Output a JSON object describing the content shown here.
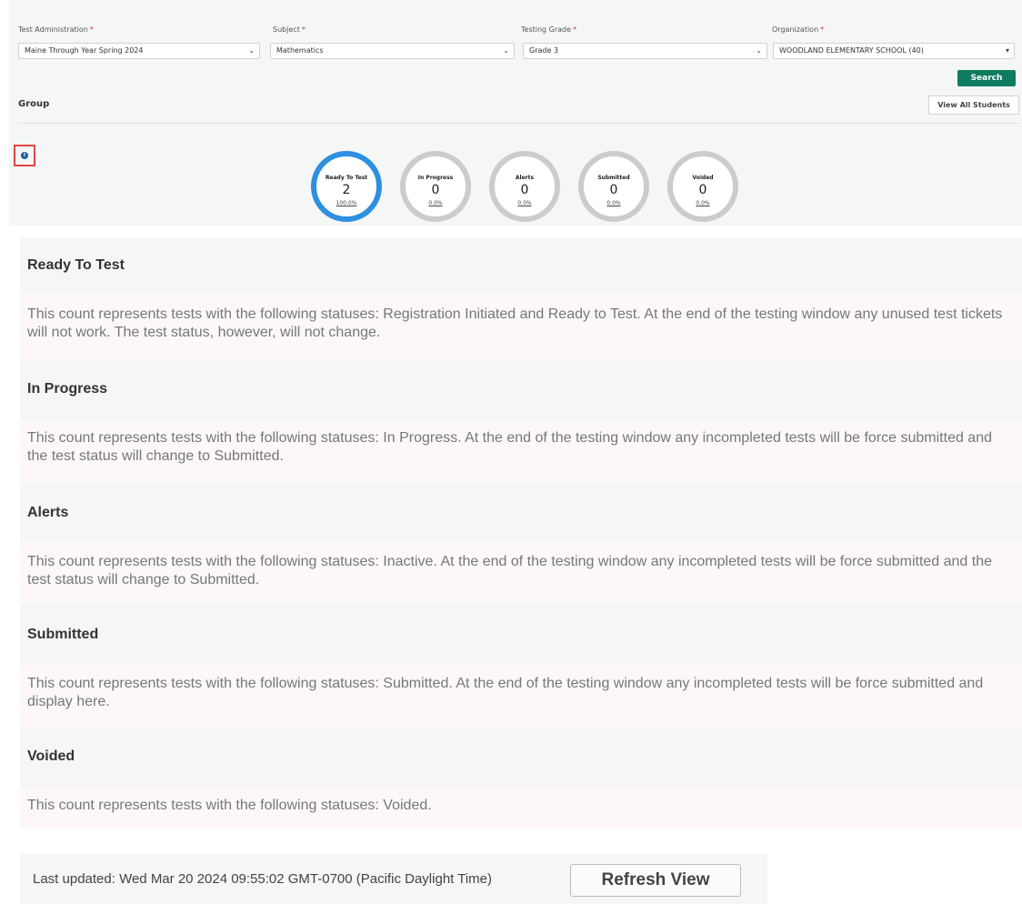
{
  "filters": {
    "test_administration": {
      "label": "Test Administration",
      "required_mark": "*",
      "value": "Maine Through Year Spring 2024"
    },
    "subject": {
      "label": "Subject",
      "required_mark": "*",
      "value": "Mathematics"
    },
    "testing_grade": {
      "label": "Testing Grade",
      "required_mark": "*",
      "value": "Grade 3"
    },
    "organization": {
      "label": "Organization",
      "required_mark": "*",
      "value": "WOODLAND ELEMENTARY SCHOOL (40)"
    },
    "caret_glyph": "⌄",
    "org_caret_glyph": "▾"
  },
  "buttons": {
    "search": "Search",
    "view_all_students": "View All Students",
    "refresh_view": "Refresh View"
  },
  "group": {
    "title": "Group"
  },
  "info_icon": {
    "glyph": "i",
    "icon": "info-icon"
  },
  "statuses": [
    {
      "label": "Ready To Test",
      "count": "2",
      "percent": "100.0%",
      "active": true
    },
    {
      "label": "In Progress",
      "count": "0",
      "percent": "0.0%",
      "active": false
    },
    {
      "label": "Alerts",
      "count": "0",
      "percent": "0.0%",
      "active": false
    },
    {
      "label": "Submitted",
      "count": "0",
      "percent": "0.0%",
      "active": false
    },
    {
      "label": "Voided",
      "count": "0",
      "percent": "0.0%",
      "active": false
    }
  ],
  "legend": [
    {
      "title": "Ready To Test",
      "description": "This count represents tests with the following statuses: Registration Initiated and Ready to Test. At the end of the testing window any unused test tickets will not work. The test status, however, will not change."
    },
    {
      "title": "In Progress",
      "description": "This count represents tests with the following statuses: In Progress. At the end of the testing window any incompleted tests will be force submitted and the test status will change to Submitted."
    },
    {
      "title": "Alerts",
      "description": "This count represents tests with the following statuses: Inactive. At the end of the testing window any incompleted tests will be force submitted and the test status will change to Submitted."
    },
    {
      "title": "Submitted",
      "description": "This count represents tests with the following statuses: Submitted. At the end of the testing window any incompleted tests will be force submitted and display here."
    },
    {
      "title": "Voided",
      "description": "This count represents tests with the following statuses: Voided."
    }
  ],
  "footer": {
    "last_updated": "Last updated: Wed Mar 20 2024 09:55:02 GMT-0700 (Pacific Daylight Time)"
  },
  "colors": {
    "accent_green": "#0f7b5f",
    "ring_active": "#2d8fe0",
    "ring_inactive": "#cccccc",
    "highlight_red": "#e04646"
  }
}
